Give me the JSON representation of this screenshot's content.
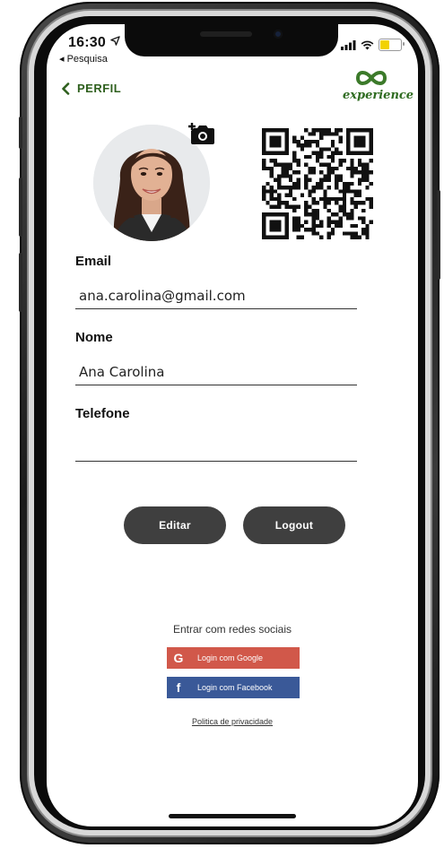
{
  "status_bar": {
    "time": "16:30",
    "back_app": "◂ Pesquisa"
  },
  "header": {
    "back_label": "PERFIL",
    "logo_text": "experience"
  },
  "profile": {
    "email_label": "Email",
    "email_value": "ana.carolina@gmail.com",
    "name_label": "Nome",
    "name_value": "Ana Carolina",
    "phone_label": "Telefone",
    "phone_value": ""
  },
  "actions": {
    "edit_label": "Editar",
    "logout_label": "Logout"
  },
  "social": {
    "title": "Entrar com redes sociais",
    "google_label": "Login com Google",
    "facebook_label": "Login com Facebook",
    "privacy_label": "Politica de privacidade"
  },
  "colors": {
    "accent_green": "#2e5f1d",
    "google_red": "#d1584a",
    "facebook_blue": "#3a5998",
    "button_dark": "#3f3f3f"
  },
  "icons": {
    "back": "chevron-left-icon",
    "camera": "camera-icon",
    "google": "google-icon",
    "facebook": "facebook-icon",
    "signal": "signal-icon",
    "wifi": "wifi-icon",
    "battery": "battery-icon",
    "location": "location-arrow-icon"
  }
}
